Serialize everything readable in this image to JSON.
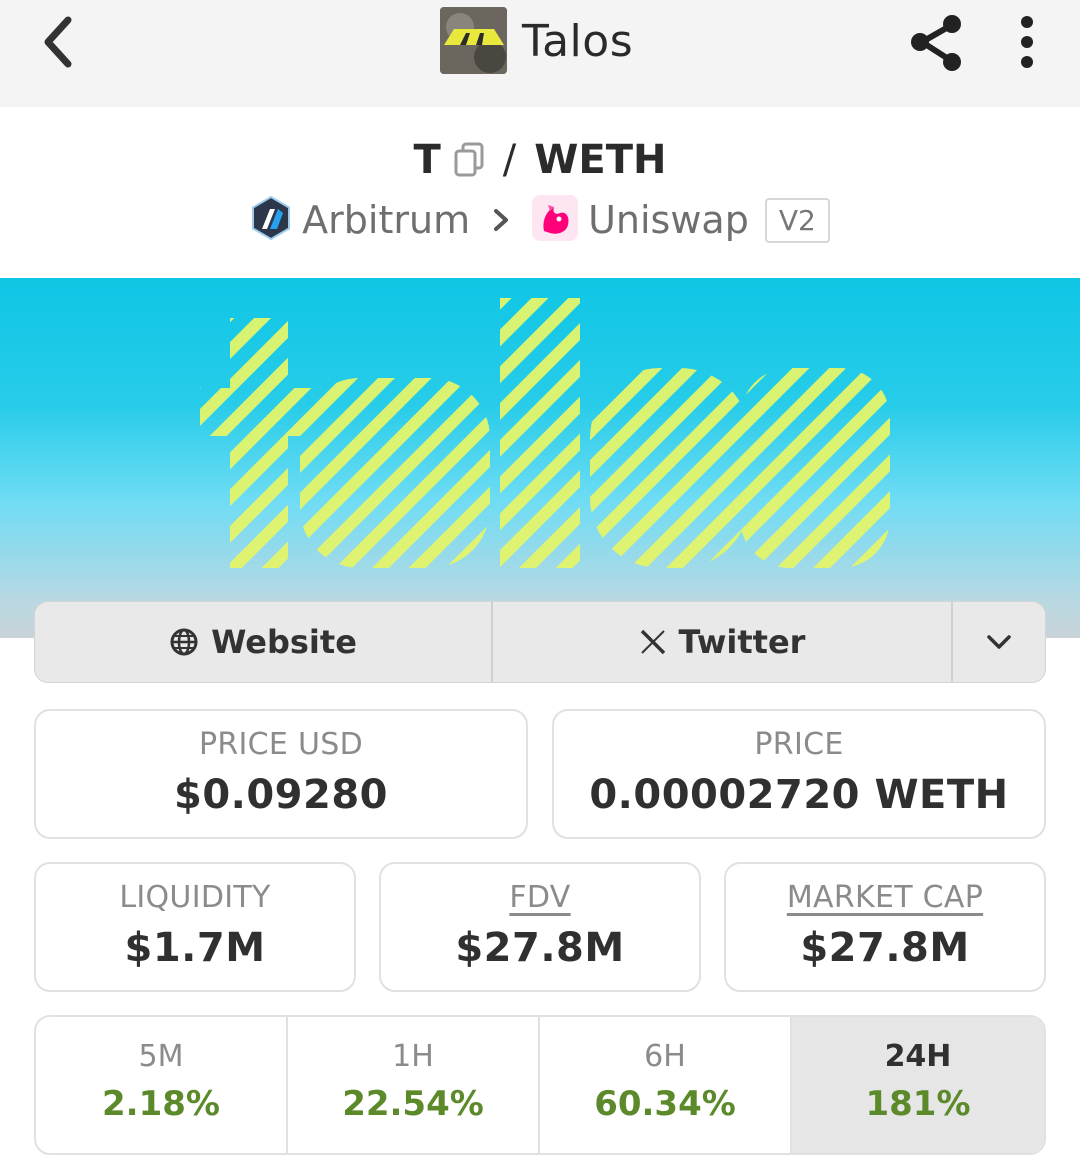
{
  "header": {
    "title": "Talos",
    "back_icon": "chevron-left-icon",
    "share_icon": "share-icon",
    "more_icon": "more-vertical-icon"
  },
  "pair": {
    "base": "T",
    "separator": "/",
    "quote": "WETH",
    "chain": "Arbitrum",
    "dex": "Uniswap",
    "dex_version": "V2"
  },
  "links": {
    "website": "Website",
    "twitter": "Twitter"
  },
  "stats": {
    "price_usd_label": "PRICE USD",
    "price_usd_value": "$0.09280",
    "price_label": "PRICE",
    "price_value": "0.00002720 WETH",
    "liquidity_label": "LIQUIDITY",
    "liquidity_value": "$1.7M",
    "fdv_label": "FDV",
    "fdv_value": "$27.8M",
    "mcap_label": "MARKET CAP",
    "mcap_value": "$27.8M"
  },
  "timeframes": [
    {
      "label": "5M",
      "value": "2.18%"
    },
    {
      "label": "1H",
      "value": "22.54%"
    },
    {
      "label": "6H",
      "value": "60.34%"
    },
    {
      "label": "24H",
      "value": "181%",
      "active": true
    }
  ],
  "colors": {
    "positive": "#5c8a2b",
    "banner_cyan": "#0fc6e5",
    "banner_letters": "#e3f56b",
    "arbitrum_blue": "#2d6fb4",
    "uniswap_pink": "#ff007a"
  }
}
